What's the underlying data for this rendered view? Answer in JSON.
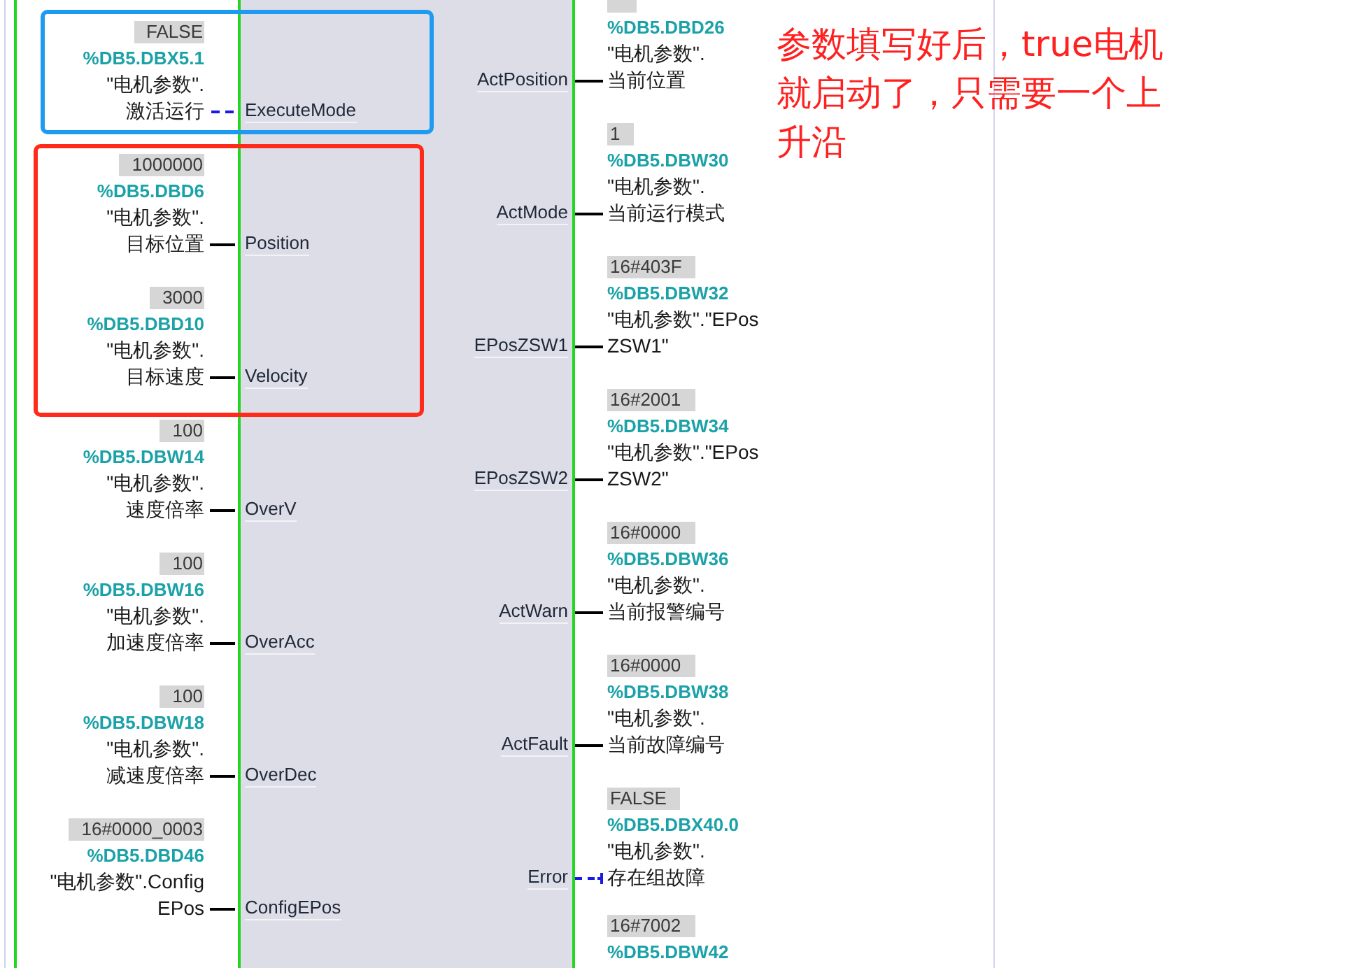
{
  "inputs": [
    {
      "pin": "ExecuteMode",
      "kind": "bool",
      "value": "FALSE",
      "address": "%DB5.DBX5.1",
      "symbol_lines": [
        "\"电机参数\".",
        "激活运行"
      ]
    },
    {
      "pin": "Position",
      "kind": "number",
      "value": "1000000",
      "address": "%DB5.DBD6",
      "symbol_lines": [
        "\"电机参数\".",
        "目标位置"
      ]
    },
    {
      "pin": "Velocity",
      "kind": "number",
      "value": "3000",
      "address": "%DB5.DBD10",
      "symbol_lines": [
        "\"电机参数\".",
        "目标速度"
      ]
    },
    {
      "pin": "OverV",
      "kind": "number",
      "value": "100",
      "address": "%DB5.DBW14",
      "symbol_lines": [
        "\"电机参数\".",
        "速度倍率"
      ]
    },
    {
      "pin": "OverAcc",
      "kind": "number",
      "value": "100",
      "address": "%DB5.DBW16",
      "symbol_lines": [
        "\"电机参数\".",
        "加速度倍率"
      ]
    },
    {
      "pin": "OverDec",
      "kind": "number",
      "value": "100",
      "address": "%DB5.DBW18",
      "symbol_lines": [
        "\"电机参数\".",
        "减速度倍率"
      ]
    },
    {
      "pin": "ConfigEPos",
      "kind": "number",
      "value": "16#0000_0003",
      "address": "%DB5.DBD46",
      "symbol_lines": [
        "\"电机参数\".Config",
        "EPos"
      ]
    }
  ],
  "outputs": [
    {
      "pin": "ActPosition",
      "kind": "number",
      "address": "%DB5.DBD26",
      "symbol_lines": [
        "\"电机参数\".",
        "当前位置"
      ]
    },
    {
      "pin": "ActMode",
      "kind": "number",
      "value": "1",
      "address": "%DB5.DBW30",
      "symbol_lines": [
        "\"电机参数\".",
        "当前运行模式"
      ]
    },
    {
      "pin": "EPosZSW1",
      "kind": "number",
      "value": "16#403F",
      "address": "%DB5.DBW32",
      "symbol_lines": [
        "\"电机参数\".\"EPos",
        "ZSW1\""
      ]
    },
    {
      "pin": "EPosZSW2",
      "kind": "number",
      "value": "16#2001",
      "address": "%DB5.DBW34",
      "symbol_lines": [
        "\"电机参数\".\"EPos",
        "ZSW2\""
      ]
    },
    {
      "pin": "ActWarn",
      "kind": "number",
      "value": "16#0000",
      "address": "%DB5.DBW36",
      "symbol_lines": [
        "\"电机参数\".",
        "当前报警编号"
      ]
    },
    {
      "pin": "ActFault",
      "kind": "number",
      "value": "16#0000",
      "address": "%DB5.DBW38",
      "symbol_lines": [
        "\"电机参数\".",
        "当前故障编号"
      ]
    },
    {
      "pin": "Error",
      "kind": "bool",
      "value": "FALSE",
      "address": "%DB5.DBX40.0",
      "symbol_lines": [
        "\"电机参数\".",
        "存在组故障"
      ]
    },
    {
      "value": "16#7002",
      "address": "%DB5.DBW42"
    }
  ],
  "highlight_frames": [
    {
      "color": "#1e9bf0"
    },
    {
      "color": "#ff2a1a"
    }
  ],
  "note": "参数填写好后，true电机就启动了，只需要一个上升沿"
}
